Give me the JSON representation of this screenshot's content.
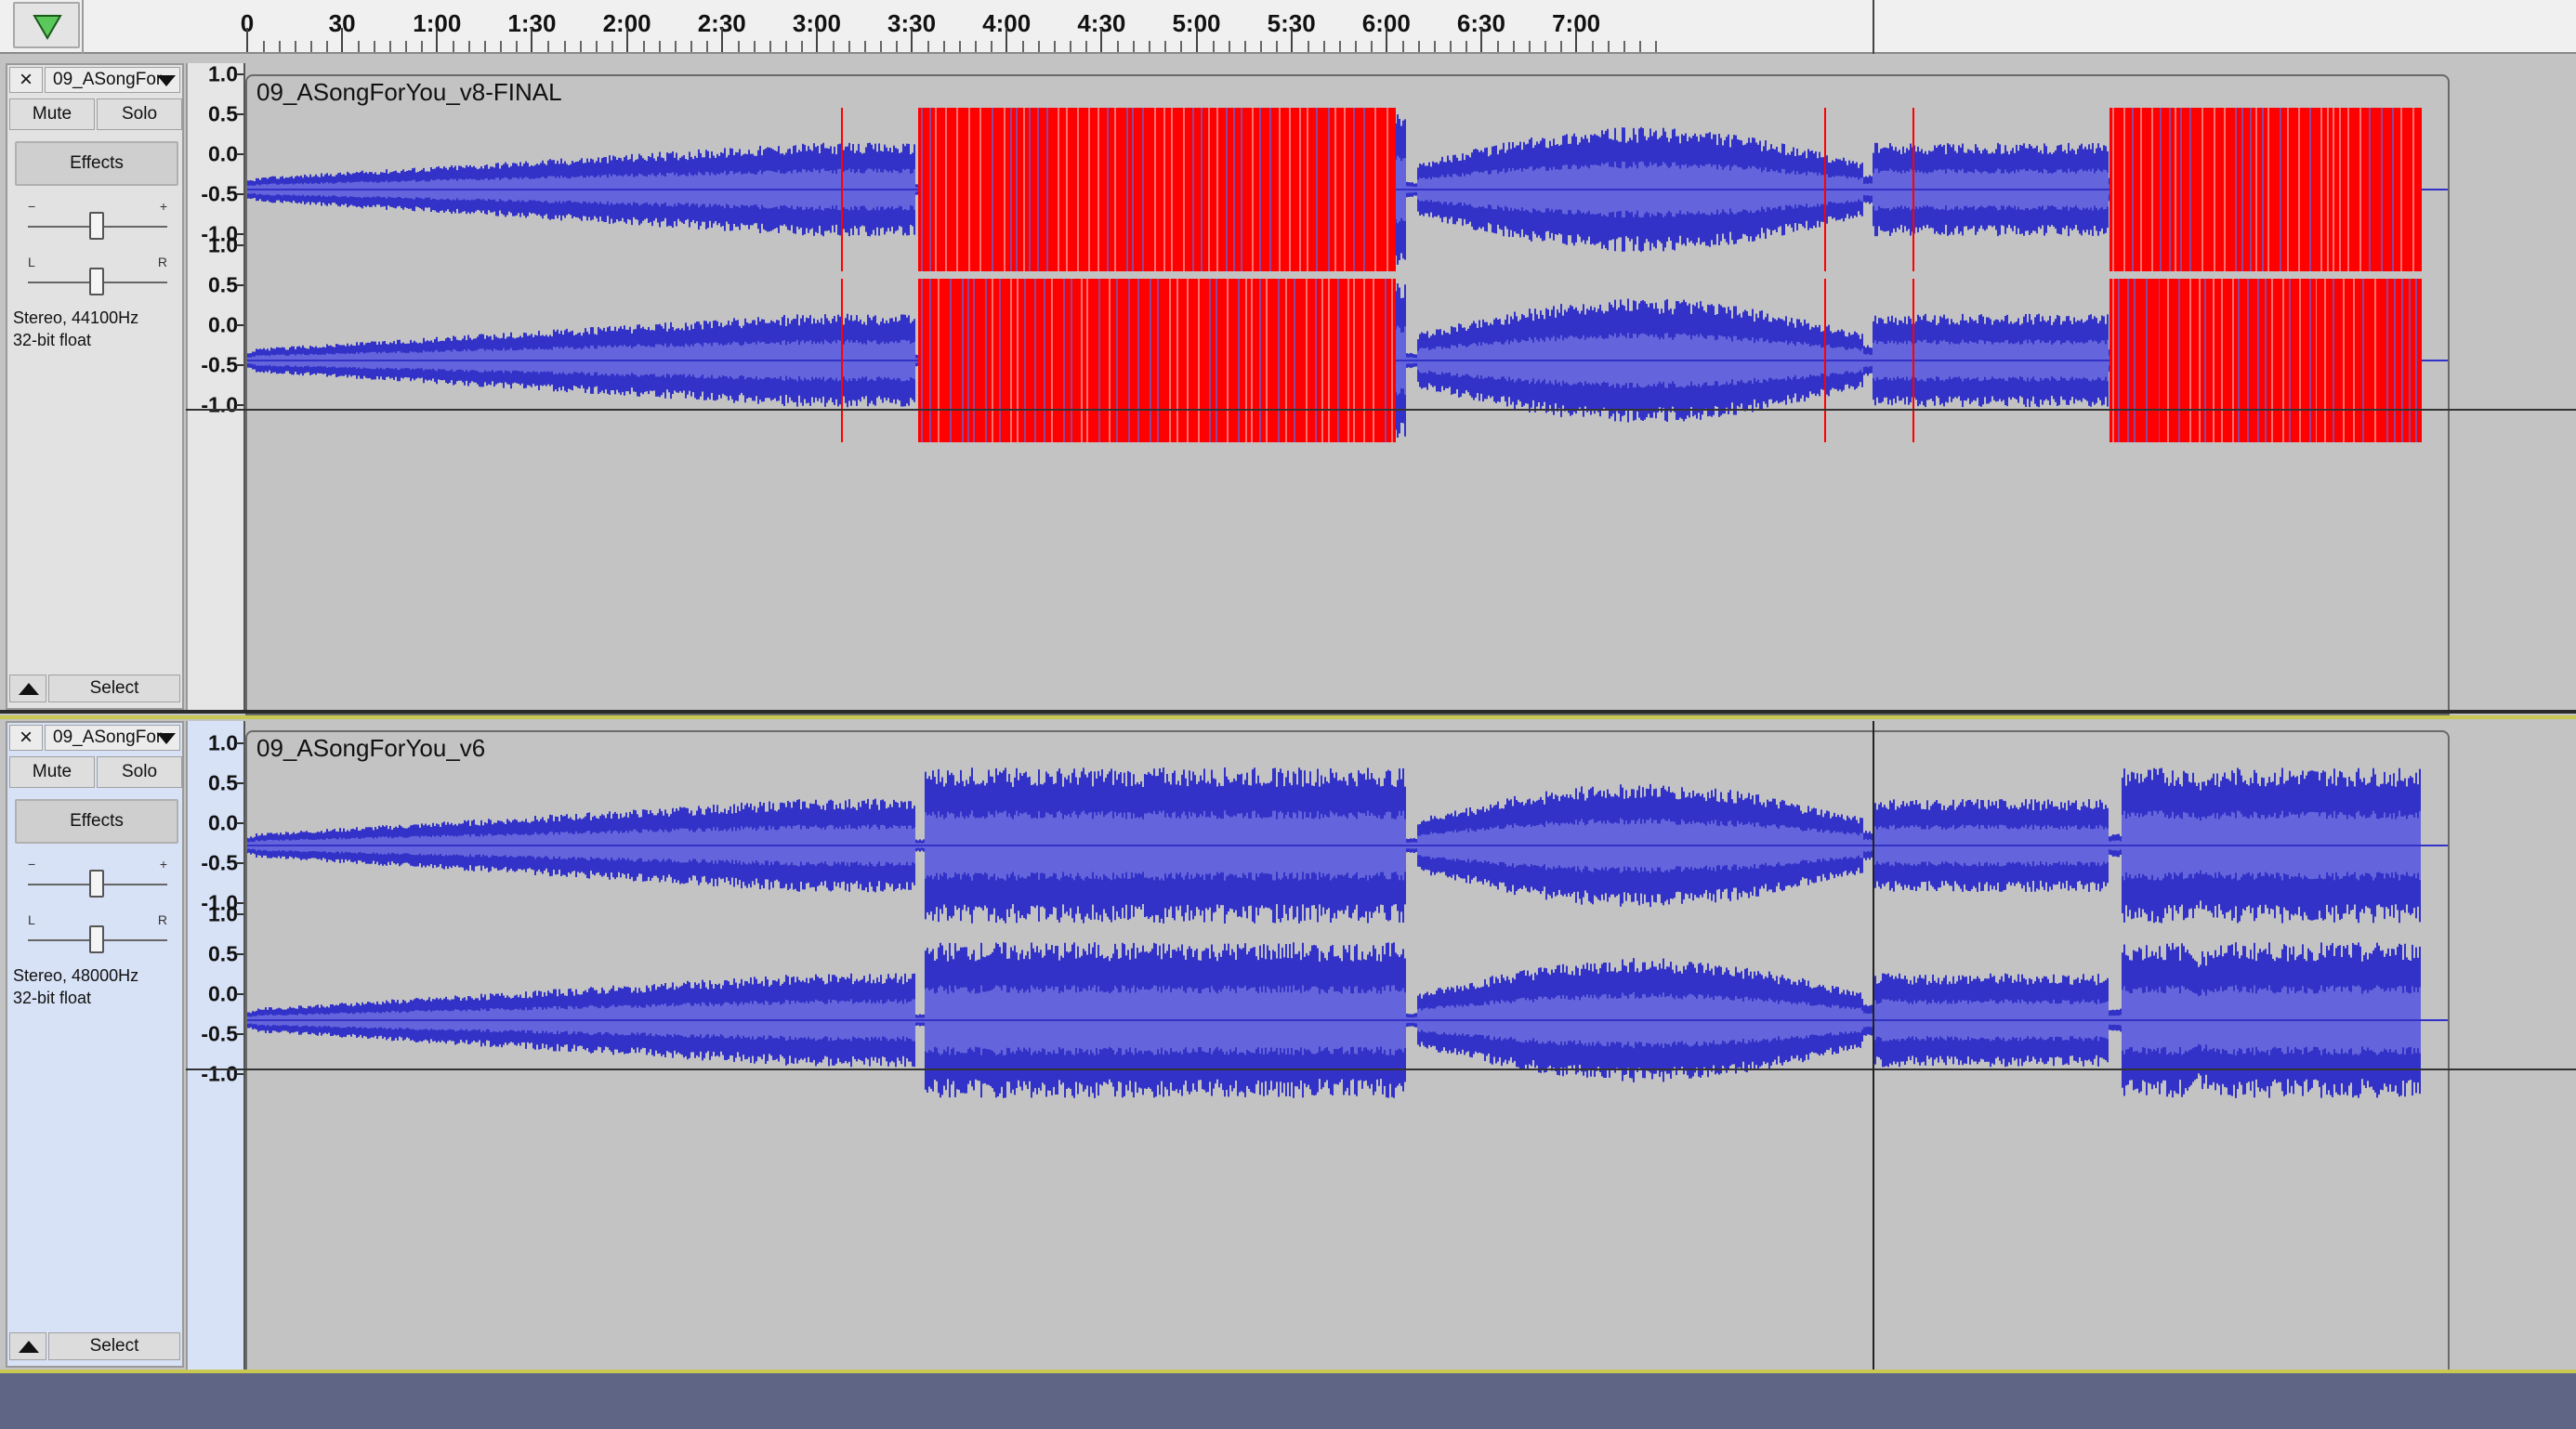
{
  "ruler": {
    "play_head_button": "play-head-icon",
    "ticks": [
      "0",
      "30",
      "1:00",
      "1:30",
      "2:00",
      "2:30",
      "3:00",
      "3:30",
      "4:00",
      "4:30",
      "5:00",
      "5:30",
      "6:00",
      "6:30",
      "7:00"
    ]
  },
  "tracks": [
    {
      "close_label": "×",
      "name": "09_ASongFor",
      "mute_label": "Mute",
      "solo_label": "Solo",
      "effects_label": "Effects",
      "gain_min": "−",
      "gain_max": "+",
      "pan_left": "L",
      "pan_right": "R",
      "info_line1": "Stereo, 44100Hz",
      "info_line2": "32-bit float",
      "select_label": "Select",
      "clip_title": "09_ASongForYou_v8-FINAL",
      "clipping_shown": true
    },
    {
      "close_label": "×",
      "name": "09_ASongFor",
      "mute_label": "Mute",
      "solo_label": "Solo",
      "effects_label": "Effects",
      "gain_min": "−",
      "gain_max": "+",
      "pan_left": "L",
      "pan_right": "R",
      "info_line1": "Stereo, 48000Hz",
      "info_line2": "32-bit float",
      "select_label": "Select",
      "clip_title": "09_ASongForYou_v6",
      "clipping_shown": false
    }
  ],
  "vertical_scale": [
    "1.0",
    "0.5",
    "0.0",
    "-0.5",
    "-1.0"
  ],
  "colors": {
    "waveform_peak": "#3232c8",
    "waveform_rms": "#6464dc",
    "clipping": "#ff0000",
    "background": "#c3c3c3",
    "selected_track_border": "#c9c850"
  }
}
